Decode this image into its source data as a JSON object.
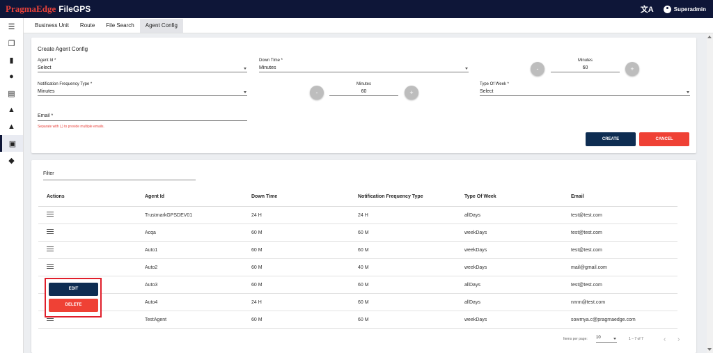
{
  "brand": {
    "name_part1": "PragmaEdge",
    "name_part2": "FileGPS"
  },
  "header": {
    "user_name": "Superadmin",
    "translate_icon": "translate-icon",
    "user_icon": "account-circle-icon"
  },
  "sidebar": {
    "items": [
      {
        "icon": "menu-icon",
        "glyph": "☰"
      },
      {
        "icon": "files-icon",
        "glyph": "❐"
      },
      {
        "icon": "bar-chart-icon",
        "glyph": "▮"
      },
      {
        "icon": "account-icon",
        "glyph": "●"
      },
      {
        "icon": "document-icon",
        "glyph": "▤"
      },
      {
        "icon": "bell-alert-icon",
        "glyph": "▲"
      },
      {
        "icon": "bell-icon",
        "glyph": "▲"
      },
      {
        "icon": "agent-config-icon",
        "glyph": "▣"
      },
      {
        "icon": "group-icon",
        "glyph": "◆"
      }
    ]
  },
  "tabs": [
    "Business Unit",
    "Route",
    "File Search",
    "Agent Config"
  ],
  "form": {
    "title": "Create Agent Config",
    "agent_id": {
      "label": "Agent Id *",
      "value": "Select"
    },
    "down_time": {
      "label": "Down Time *",
      "value": "Minutes"
    },
    "down_minutes": {
      "label": "Minutes",
      "value": "60"
    },
    "notif_type": {
      "label": "Notification Frequency Type *",
      "value": "Minutes"
    },
    "notif_minutes": {
      "label": "Minutes",
      "value": "60"
    },
    "type_of_week": {
      "label": "Type Of Week *",
      "value": "Select"
    },
    "email": {
      "label": "Email *",
      "hint": "Separate with (,) to provide multiple emails."
    },
    "minus": "-",
    "plus": "+",
    "create_label": "CREATE",
    "cancel_label": "CANCEL"
  },
  "table": {
    "filter_label": "Filter",
    "headers": [
      "Actions",
      "Agent Id",
      "Down Time",
      "Notification Frequency Type",
      "Type Of Week",
      "Email"
    ],
    "rows": [
      [
        "TrustmarkGPSDEV01",
        "24 H",
        "24 H",
        "allDays",
        "test@test.com"
      ],
      [
        "Acqa",
        "60 M",
        "60 M",
        "weekDays",
        "test@test.com"
      ],
      [
        "Auto1",
        "60 M",
        "60 M",
        "weekDays",
        "test@test.com"
      ],
      [
        "Auto2",
        "60 M",
        "40 M",
        "weekDays",
        "mail@gmail.com"
      ],
      [
        "Auto3",
        "60 M",
        "60 M",
        "allDays",
        "test@test.com"
      ],
      [
        "Auto4",
        "24 H",
        "60 M",
        "allDays",
        "nnnn@test.com"
      ],
      [
        "TestAgent",
        "60 M",
        "60 M",
        "weekDays",
        "sowmya.c@pragmaedge.com"
      ]
    ],
    "actions_menu": {
      "edit_label": "EDIT",
      "delete_label": "DELETE"
    }
  },
  "paginator": {
    "items_per_page_label": "Items per page:",
    "page_size": "10",
    "range": "1 – 7 of 7",
    "prev": "‹",
    "next": "›"
  },
  "colors": {
    "navy": "#0e1638",
    "accent_red": "#ef4135",
    "button_navy": "#0e2d52"
  }
}
